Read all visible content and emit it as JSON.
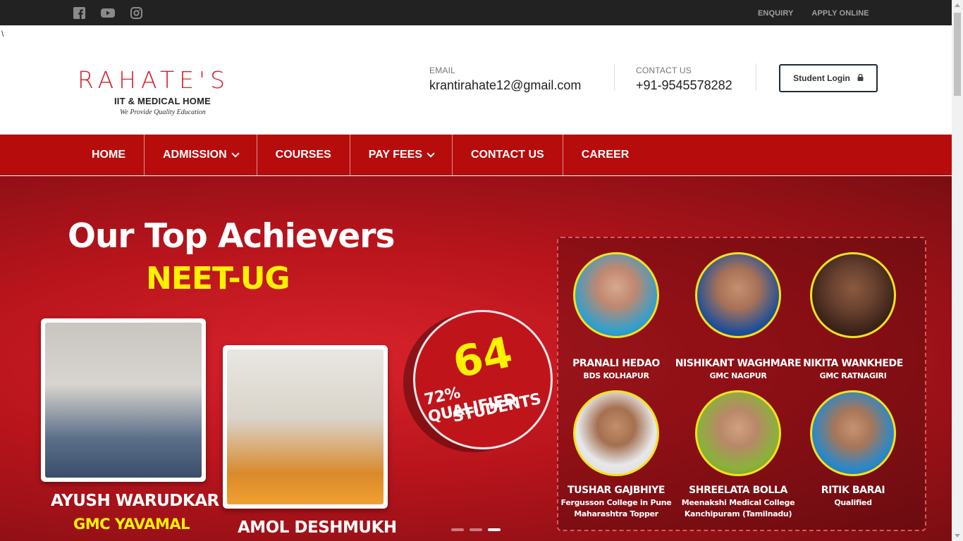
{
  "topbar": {
    "social": [
      "facebook-icon",
      "youtube-icon",
      "instagram-icon"
    ],
    "links": {
      "enquiry": "ENQUIRY",
      "apply": "APPLY ONLINE"
    }
  },
  "stray_text": "\\",
  "logo": {
    "brand": "RAHATE'S",
    "subtitle": "IIT & MEDICAL HOME",
    "tagline": "We Provide Quality Education"
  },
  "contact": {
    "email_label": "EMAIL",
    "email_value": "krantirahate12@gmail.com",
    "phone_label": "CONTACT US",
    "phone_value": "+91-9545578282"
  },
  "login": {
    "label": "Student Login",
    "icon": "lock-icon"
  },
  "nav": {
    "home": "HOME",
    "admission": "ADMISSION",
    "courses": "COURSES",
    "pay_fees": "PAY FEES",
    "contact_us": "CONTACT US",
    "career": "CAREER"
  },
  "hero": {
    "title": "Our Top Achievers",
    "subtitle": "NEET-UG",
    "featured": [
      {
        "name": "AYUSH WARUDKAR",
        "college": "GMC YAVAMAL"
      },
      {
        "name": "AMOL DESHMUKH"
      }
    ],
    "badge": {
      "number": "64",
      "line1": "72% QUALIFIED",
      "line2": "STUDENTS"
    },
    "achievers": [
      {
        "name": "PRANALI HEDAO",
        "college": "BDS KOLHAPUR"
      },
      {
        "name": "NISHIKANT WAGHMARE",
        "college": "GMC NAGPUR"
      },
      {
        "name": "NIKITA WANKHEDE",
        "college": "GMC RATNAGIRI"
      },
      {
        "name": "TUSHAR GAJBHIYE",
        "college": "Fergusson College in Pune Maharashtra Topper"
      },
      {
        "name": "SHREELATA BOLLA",
        "college": "Meenakshi Medical College Kanchipuram (Tamilnadu)"
      },
      {
        "name": "RITIK BARAI",
        "college": "Qualified"
      }
    ],
    "slider_active_index": 2
  },
  "colors": {
    "accent": "#b70c0c",
    "brand": "#d41f2a",
    "highlight": "#fff200",
    "topbar": "#222222"
  }
}
